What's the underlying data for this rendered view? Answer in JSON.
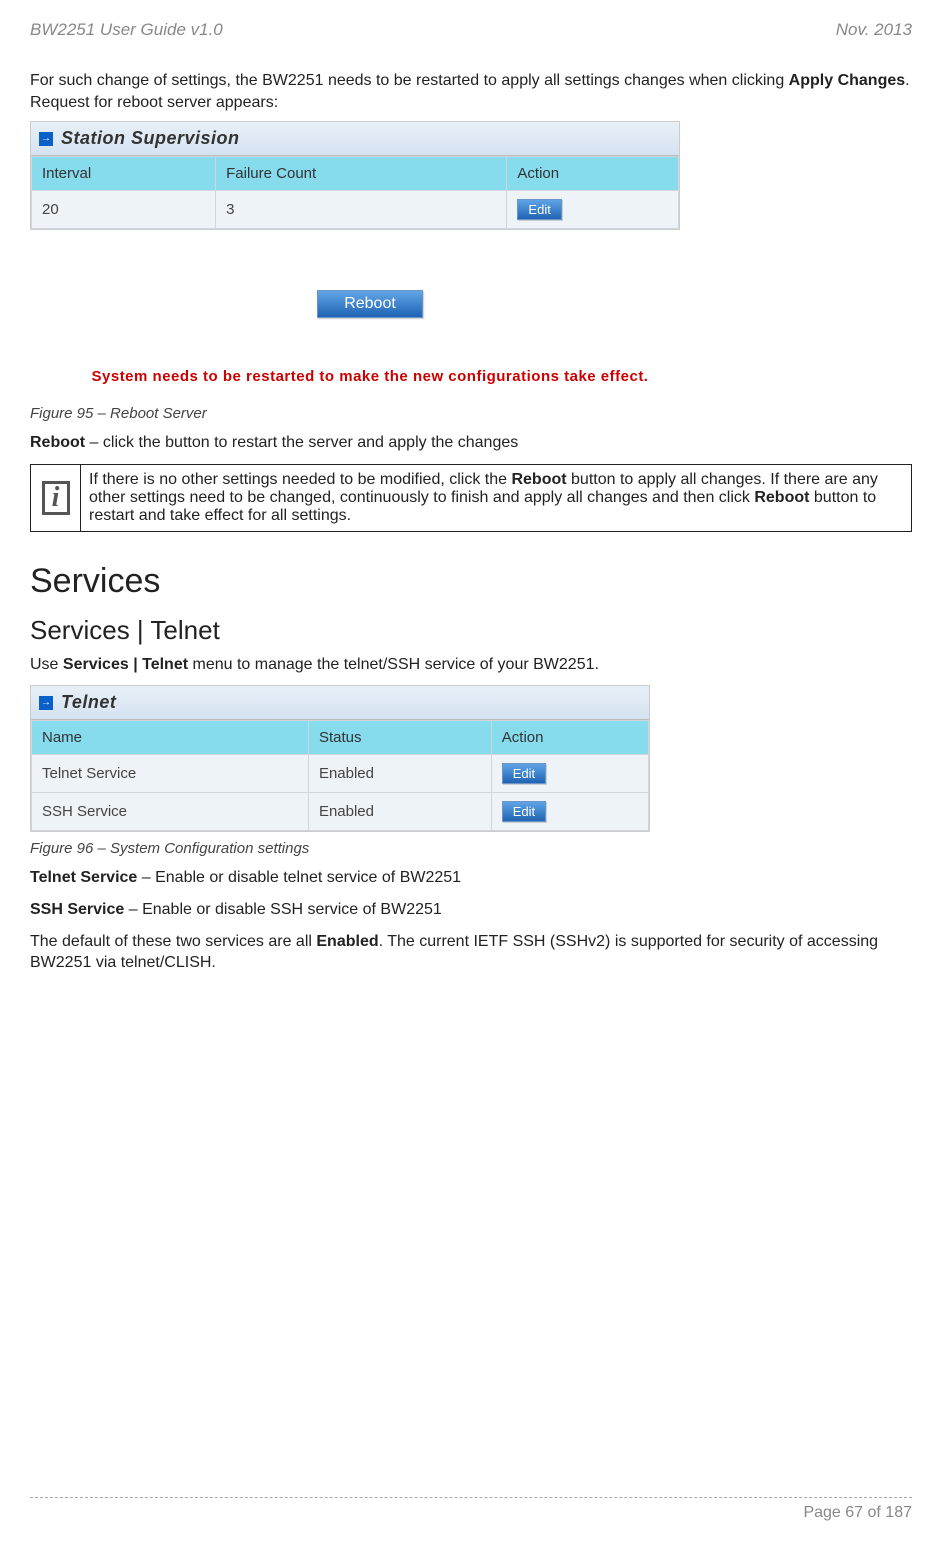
{
  "header": {
    "left": "BW2251 User Guide v1.0",
    "right": "Nov.  2013"
  },
  "intro": {
    "part1": "For such change of settings, the BW2251 needs to be restarted to apply all settings changes when clicking ",
    "bold1": "Apply Changes",
    "part2": ". Request for reboot server appears:"
  },
  "supervision_panel": {
    "title": "Station Supervision",
    "headers": [
      "Interval",
      "Failure Count",
      "Action"
    ],
    "row": {
      "interval": "20",
      "failure_count": "3",
      "edit_label": "Edit"
    }
  },
  "reboot": {
    "button_label": "Reboot",
    "restart_message": "System needs to be restarted to make the new configurations take effect."
  },
  "figure95": "Figure 95 – Reboot Server",
  "reboot_text": {
    "bold": "Reboot",
    "rest": " – click the button to restart the server and apply the changes"
  },
  "info_box": {
    "part1": "If there is no other settings needed to be modified, click the ",
    "bold1": "Reboot",
    "part2": " button to apply all changes. If there are any other settings need to be changed, continuously to finish and apply all changes and then click ",
    "bold2": "Reboot",
    "part3": " button to restart and take effect  for all settings."
  },
  "services_heading": "Services",
  "telnet_heading": "Services | Telnet",
  "telnet_intro": {
    "part1": "Use ",
    "bold": "Services | Telnet",
    "part2": " menu to manage the telnet/SSH service of your BW2251."
  },
  "telnet_panel": {
    "title": "Telnet",
    "headers": [
      "Name",
      "Status",
      "Action"
    ],
    "rows": [
      {
        "name": "Telnet Service",
        "status": "Enabled",
        "edit_label": "Edit"
      },
      {
        "name": "SSH Service",
        "status": "Enabled",
        "edit_label": "Edit"
      }
    ]
  },
  "figure96": "Figure 96 – System Configuration settings",
  "telnet_service_line": {
    "bold": "Telnet Service",
    "rest": " – Enable or disable telnet service of BW2251"
  },
  "ssh_service_line": {
    "bold": "SSH Service",
    "rest": " – Enable or disable SSH service of BW2251"
  },
  "default_line": {
    "part1": "The default of these two services are all ",
    "bold": "Enabled",
    "part2": ". The current IETF SSH (SSHv2) is supported for security of accessing BW2251 via telnet/CLISH."
  },
  "footer": "Page 67 of 187"
}
